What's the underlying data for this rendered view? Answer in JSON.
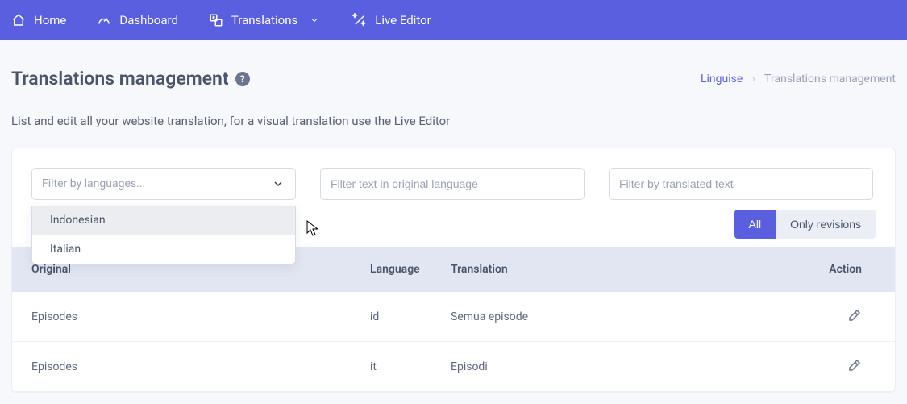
{
  "nav": {
    "home": "Home",
    "dashboard": "Dashboard",
    "translations": "Translations",
    "live_editor": "Live Editor"
  },
  "page": {
    "title": "Translations management",
    "subtitle": "List and edit all your website translation, for a visual translation use the Live Editor"
  },
  "breadcrumb": {
    "root": "Linguise",
    "current": "Translations management"
  },
  "filters": {
    "language_placeholder": "Filter by languages...",
    "language_options": [
      "Indonesian",
      "Italian"
    ],
    "original_placeholder": "Filter text in original language",
    "translated_placeholder": "Filter by translated text"
  },
  "segmented": {
    "all": "All",
    "revisions": "Only revisions"
  },
  "table": {
    "headers": {
      "original": "Original",
      "language": "Language",
      "translation": "Translation",
      "action": "Action"
    },
    "rows": [
      {
        "original": "Episodes",
        "language": "id",
        "translation": "Semua episode"
      },
      {
        "original": "Episodes",
        "language": "it",
        "translation": "Episodi"
      }
    ]
  }
}
